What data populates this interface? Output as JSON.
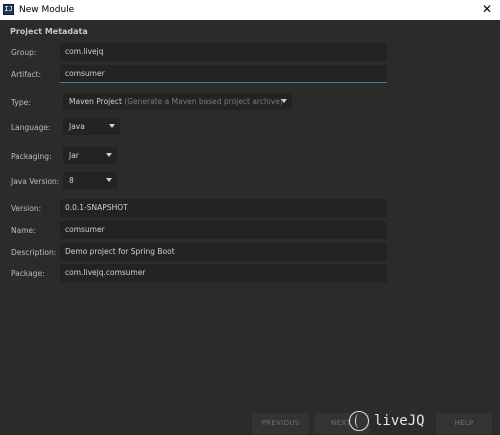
{
  "window": {
    "title": "New Module",
    "app_icon": "intellij-icon",
    "close_glyph": "✕"
  },
  "section_title": "Project Metadata",
  "form": {
    "group": {
      "label": "Group:",
      "value": "com.livejq"
    },
    "artifact": {
      "label": "Artifact:",
      "value": "comsumer"
    },
    "type": {
      "label": "Type:",
      "value": "Maven Project",
      "hint": "(Generate a Maven based project archive)"
    },
    "language": {
      "label": "Language:",
      "value": "Java"
    },
    "packaging": {
      "label": "Packaging:",
      "value": "Jar"
    },
    "java_version": {
      "label": "Java Version:",
      "value": "8"
    },
    "version": {
      "label": "Version:",
      "value": "0.0.1-SNAPSHOT"
    },
    "name": {
      "label": "Name:",
      "value": "comsumer"
    },
    "description": {
      "label": "Description:",
      "value": "Demo project for Spring Boot"
    },
    "package": {
      "label": "Package:",
      "value": "com.livejq.comsumer"
    }
  },
  "footer": {
    "previous": "PREVIOUS",
    "next": "NEXT",
    "help": "HELP"
  },
  "watermark": {
    "text": "liveJQ"
  },
  "colors": {
    "background": "#2b2b2b",
    "field_background": "#232323",
    "focus_underline": "#4d7e94"
  }
}
